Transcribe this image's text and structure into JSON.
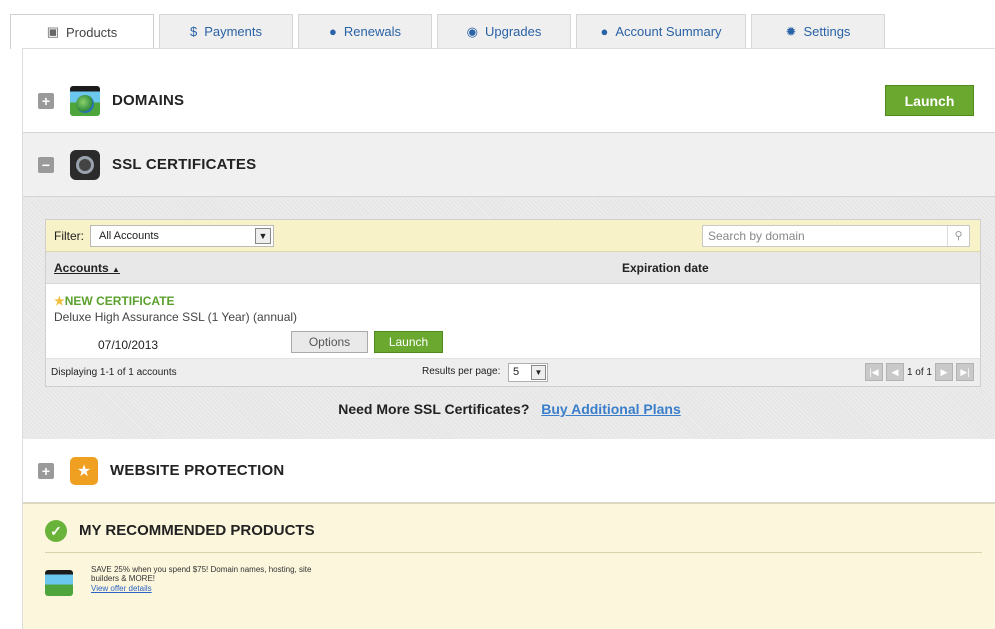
{
  "tabs": [
    {
      "label": "Products",
      "icon": "box-icon"
    },
    {
      "label": "Payments",
      "icon": "dollar-icon"
    },
    {
      "label": "Renewals",
      "icon": "info-icon"
    },
    {
      "label": "Upgrades",
      "icon": "circle-icon"
    },
    {
      "label": "Account Summary",
      "icon": "user-icon"
    },
    {
      "label": "Settings",
      "icon": "gear-icon"
    }
  ],
  "domains": {
    "title": "DOMAINS",
    "expander": "+",
    "launch_label": "Launch"
  },
  "ssl": {
    "title": "SSL CERTIFICATES",
    "expander": "−",
    "filter_label": "Filter:",
    "filter_value": "All Accounts",
    "search_placeholder": "Search by domain",
    "col_accounts": "Accounts",
    "sort_indicator": "▲",
    "col_expiration": "Expiration date",
    "row": {
      "title": "NEW CERTIFICATE",
      "description": "Deluxe High Assurance SSL (1 Year) (annual)",
      "date": "07/10/2013",
      "options_label": "Options",
      "launch_label": "Launch"
    },
    "displaying": "Displaying 1-1 of 1 accounts",
    "results_per_page_label": "Results per page:",
    "results_per_page_value": "5",
    "page_info": "1 of 1",
    "more_text": "Need More SSL Certificates?",
    "more_link": "Buy Additional Plans"
  },
  "website_protection": {
    "title": "WEBSITE PROTECTION",
    "expander": "+"
  },
  "recommended": {
    "title": "MY RECOMMENDED PRODUCTS",
    "promo_text": "SAVE 25% when you spend $75! Domain names, hosting, site builders & MORE!",
    "promo_link": "View offer details"
  },
  "colors": {
    "accent_green": "#6aa82f",
    "link_blue": "#3a7ecb",
    "filter_yellow": "#f7f2c8",
    "rec_bg": "#fbf6dc"
  }
}
